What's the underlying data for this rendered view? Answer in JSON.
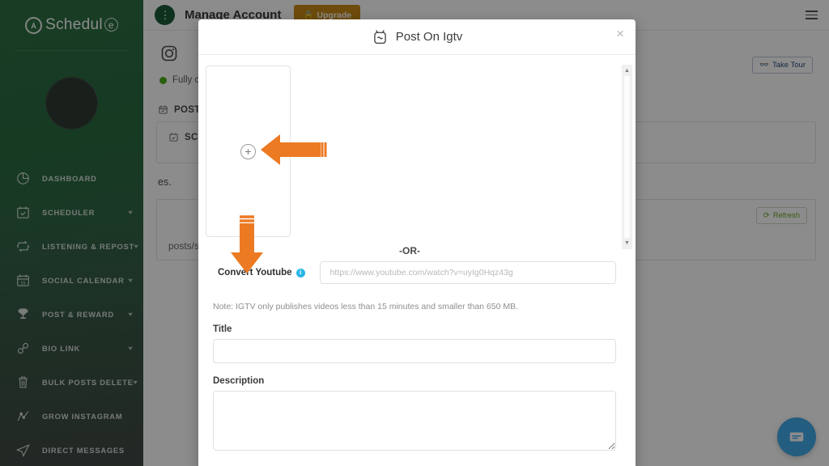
{
  "sidebar": {
    "logo_text": "Schedul",
    "logo_mark": "Ai",
    "logo_suffix": "e",
    "items": [
      {
        "label": "DASHBOARD",
        "icon": "pie-chart-icon",
        "caret": ""
      },
      {
        "label": "SCHEDULER",
        "icon": "calendar-check-icon",
        "caret": "▾"
      },
      {
        "label": "LISTENING & REPOST",
        "icon": "repost-icon",
        "caret": "▾"
      },
      {
        "label": "SOCIAL CALENDAR",
        "icon": "calendar-icon",
        "caret": "▾"
      },
      {
        "label": "POST & REWARD",
        "icon": "trophy-icon",
        "caret": "▾"
      },
      {
        "label": "BIO LINK",
        "icon": "link-icon",
        "caret": "▾"
      },
      {
        "label": "BULK POSTS DELETE",
        "icon": "trash-icon",
        "caret": "▾"
      },
      {
        "label": "GROW INSTAGRAM",
        "icon": "growth-chart-icon",
        "caret": ""
      },
      {
        "label": "DIRECT MESSAGES",
        "icon": "send-icon",
        "caret": ""
      }
    ]
  },
  "topbar": {
    "account_title": "Manage Account",
    "upgrade_label": "Upgrade",
    "menu_icon": "hamburger-icon"
  },
  "page": {
    "status_text": "Fully c",
    "take_tour_label": "Take Tour",
    "posts_section": "POSTS",
    "scheduled_section": "SC",
    "sentence_fragment": "es.",
    "refresh_label": "Refresh",
    "schedule_note": "posts/stories for",
    "instagram_icon": "instagram-icon"
  },
  "modal": {
    "title": "Post On Igtv",
    "icon": "igtv-icon",
    "close_label": "×",
    "upload_plus": "+",
    "or_label": "-OR-",
    "convert_label": "Convert Youtube",
    "info_icon_char": "i",
    "youtube_placeholder": "https://www.youtube.com/watch?v=uyIg0Hqz43g",
    "youtube_value": "",
    "note": "Note: IGTV only publishes videos less than 15 minutes and smaller than 650 MB.",
    "title_label": "Title",
    "title_value": "",
    "description_label": "Description",
    "description_value": ""
  },
  "annotations": {
    "arrow_left_target": "upload-plus-button",
    "arrow_down_target": "convert-youtube-label",
    "arrow_color": "#ec7a23"
  },
  "colors": {
    "sidebar_green": "#2c6e43",
    "upgrade_gold": "#c98a16",
    "accent_orange": "#ec7a23",
    "chat_blue": "#41aaea",
    "info_cyan": "#29b6e8",
    "refresh_green": "#6aa524",
    "status_green": "#4caf16"
  }
}
